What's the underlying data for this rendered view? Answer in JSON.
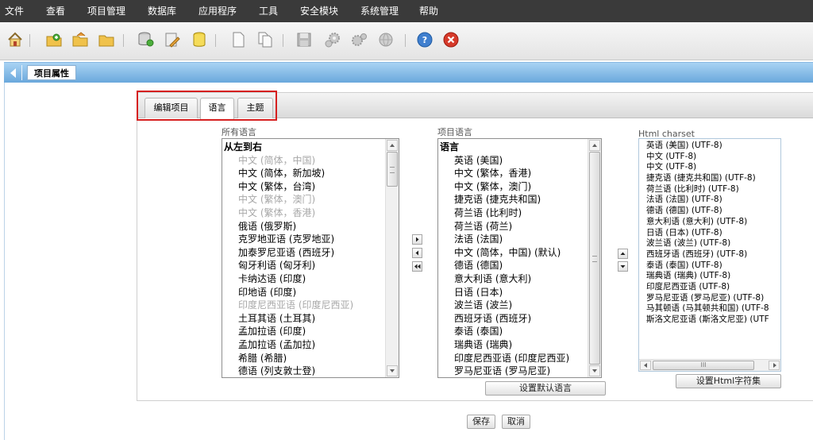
{
  "menubar": {
    "items": [
      "文件",
      "查看",
      "项目管理",
      "数据库",
      "应用程序",
      "工具",
      "安全模块",
      "系统管理",
      "帮助"
    ]
  },
  "toolbar": {
    "icons": [
      "home-icon",
      "new-project-icon",
      "open-project-icon",
      "folder-icon",
      "database-add-icon",
      "database-edit-icon",
      "database-icon",
      "new-document-icon",
      "copy-document-icon",
      "save-icon",
      "settings-icon",
      "settings-multi-icon",
      "globe-icon",
      "help-icon",
      "close-icon"
    ]
  },
  "titlebar": {
    "label": "项目属性"
  },
  "tabs": [
    {
      "label": "编辑项目"
    },
    {
      "label": "语言",
      "active": true
    },
    {
      "label": "主题"
    }
  ],
  "all_languages": {
    "label": "所有语言",
    "header": "从左到右",
    "items": [
      {
        "text": "中文 (简体，中国)",
        "disabled": true
      },
      {
        "text": "中文 (简体，新加坡)",
        "disabled": false
      },
      {
        "text": "中文 (繁体，台湾)",
        "disabled": false
      },
      {
        "text": "中文 (繁体，澳门)",
        "disabled": true
      },
      {
        "text": "中文 (繁体，香港)",
        "disabled": true
      },
      {
        "text": "俄语 (俄罗斯)",
        "disabled": false
      },
      {
        "text": "克罗地亚语 (克罗地亚)",
        "disabled": false
      },
      {
        "text": "加泰罗尼亚语 (西班牙)",
        "disabled": false
      },
      {
        "text": "匈牙利语 (匈牙利)",
        "disabled": false
      },
      {
        "text": "卡纳达语 (印度)",
        "disabled": false
      },
      {
        "text": "印地语 (印度)",
        "disabled": false
      },
      {
        "text": "印度尼西亚语 (印度尼西亚)",
        "disabled": true
      },
      {
        "text": "土耳其语 (土耳其)",
        "disabled": false
      },
      {
        "text": "孟加拉语 (印度)",
        "disabled": false
      },
      {
        "text": "孟加拉语 (孟加拉)",
        "disabled": false
      },
      {
        "text": "希腊 (希腊)",
        "disabled": false
      },
      {
        "text": "德语 (列支敦士登)",
        "disabled": false
      }
    ]
  },
  "project_languages": {
    "label": "项目语言",
    "header": "语言",
    "items": [
      "英语 (美国)",
      "中文 (繁体，香港)",
      "中文 (繁体，澳门)",
      "捷克语 (捷克共和国)",
      "荷兰语 (比利时)",
      "荷兰语 (荷兰)",
      "法语 (法国)",
      "中文 (简体，中国) (默认)",
      "德语 (德国)",
      "意大利语 (意大利)",
      "日语 (日本)",
      "波兰语 (波兰)",
      "西班牙语 (西班牙)",
      "泰语 (泰国)",
      "瑞典语 (瑞典)",
      "印度尼西亚语 (印度尼西亚)",
      "罗马尼亚语 (罗马尼亚)"
    ],
    "default_button": "设置默认语言"
  },
  "charset": {
    "label": "Html charset",
    "items": [
      "英语 (美国) (UTF-8)",
      "中文 (UTF-8)",
      "中文 (UTF-8)",
      "捷克语 (捷克共和国) (UTF-8)",
      "荷兰语 (比利时) (UTF-8)",
      "法语 (法国) (UTF-8)",
      "德语 (德国) (UTF-8)",
      "意大利语 (意大利) (UTF-8)",
      "日语 (日本) (UTF-8)",
      "波兰语 (波兰) (UTF-8)",
      "西班牙语 (西班牙) (UTF-8)",
      "泰语 (泰国) (UTF-8)",
      "瑞典语 (瑞典) (UTF-8)",
      "印度尼西亚语 (UTF-8)",
      "罗马尼亚语 (罗马尼亚) (UTF-8)",
      "马其顿语 (马其顿共和国) (UTF-8",
      "斯洛文尼亚语 (斯洛文尼亚) (UTF"
    ],
    "scroll_grip": "III",
    "set_button": "设置Html字符集"
  },
  "footer": {
    "save": "保存",
    "cancel": "取消"
  },
  "colors": {
    "menubar": "#3a3a3a",
    "titlebar": "#6aa8dc",
    "highlight": "#d62020"
  }
}
